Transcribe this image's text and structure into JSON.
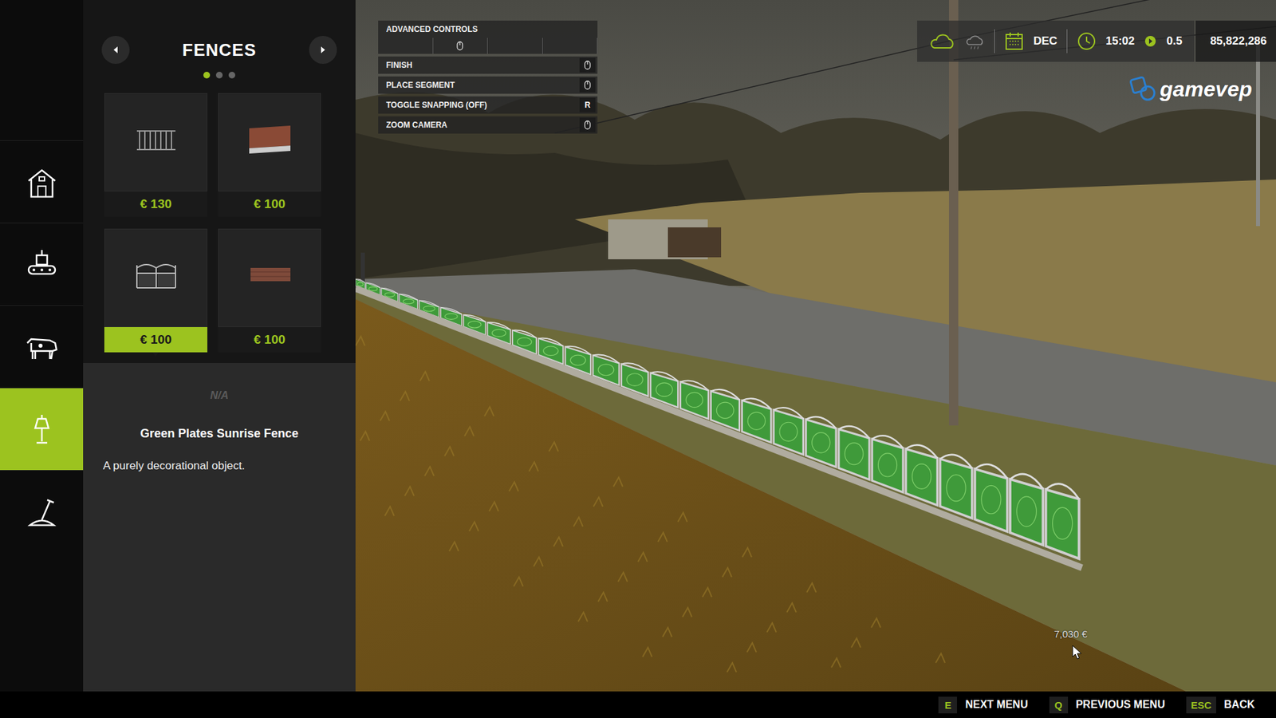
{
  "categories": [
    {
      "selected": false
    },
    {
      "selected": false
    },
    {
      "selected": false
    },
    {
      "selected": true
    },
    {
      "selected": false
    }
  ],
  "panel": {
    "title": "FENCES",
    "pages": [
      {
        "selected": true
      },
      {
        "selected": false
      },
      {
        "selected": false
      }
    ],
    "items": [
      {
        "kind": "railing",
        "price": "€ 130",
        "selected": false
      },
      {
        "kind": "brick",
        "price": "€ 100",
        "selected": false
      },
      {
        "kind": "ornate",
        "price": "€ 100",
        "selected": true
      },
      {
        "kind": "brick-low",
        "price": "€ 100",
        "selected": false
      },
      {
        "kind": "stone",
        "selected": false
      },
      {
        "kind": "brick-wall",
        "selected": false
      }
    ]
  },
  "description": {
    "status": "N/A",
    "name": "Green Plates Sunrise Fence",
    "text": "A purely decorational object."
  },
  "controls": {
    "title": "ADVANCED CONTROLS",
    "rows": [
      {
        "label": "FINISH",
        "kind": "mouse"
      },
      {
        "label": "PLACE SEGMENT",
        "kind": "mouse"
      },
      {
        "label": "TOGGLE SNAPPING (OFF)",
        "kind": "key",
        "key": "R"
      },
      {
        "label": "ZOOM CAMERA",
        "kind": "mouse"
      }
    ]
  },
  "hud": {
    "month": "DEC",
    "time": "15:02",
    "speed": "0.5",
    "money": "85,822,286"
  },
  "watermark": "gamevep",
  "cursor_tooltip": "7,030 €",
  "footer": [
    {
      "key": "E",
      "label": "NEXT MENU"
    },
    {
      "key": "Q",
      "label": "PREVIOUS MENU"
    },
    {
      "key": "ESC",
      "label": "BACK"
    }
  ]
}
